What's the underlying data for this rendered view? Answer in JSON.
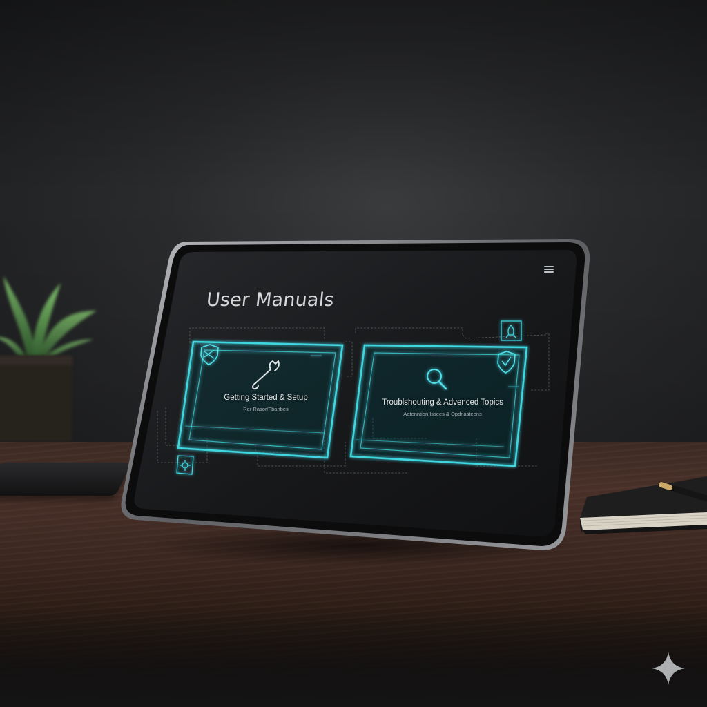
{
  "screen": {
    "title": "User Manuals",
    "menu_icon": "hamburger-menu-icon",
    "accent_color": "#3fd6e0",
    "background_color": "#151618"
  },
  "cards": [
    {
      "title": "Getting Started & Setup",
      "subtitle": "Rer Rasor/Fbanbes",
      "icon": "wrench-icon",
      "badge_icon": "shield-tools-icon"
    },
    {
      "title": "Troublshouting & Advenced Topics",
      "subtitle": "Aatenntion Issees & Opdnasteens",
      "icon": "magnifier-icon",
      "badge_icon": "shield-check-icon"
    }
  ],
  "floating_icons": [
    "gear-icon",
    "rocket-icon"
  ],
  "corner_mark_icon": "sparkle-icon"
}
